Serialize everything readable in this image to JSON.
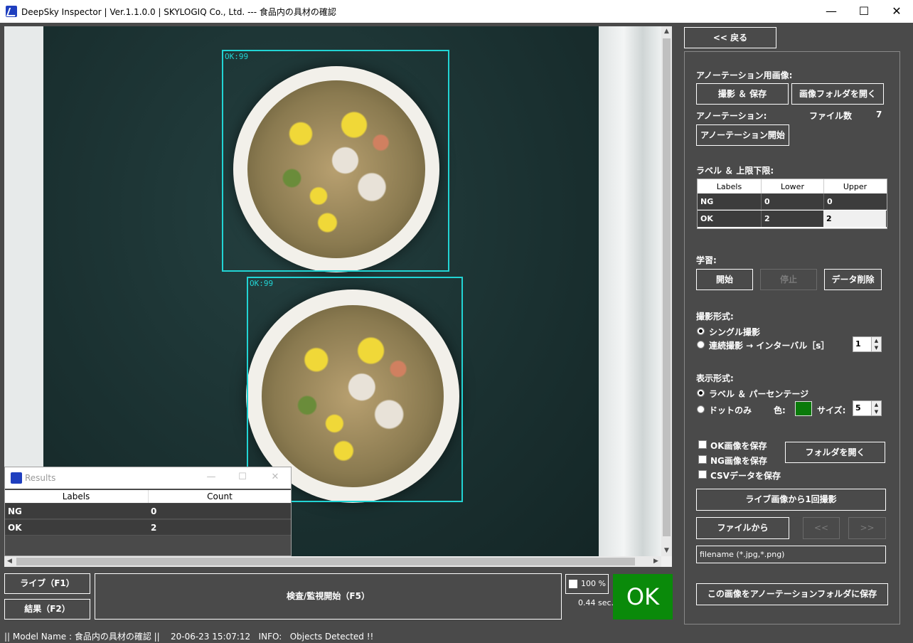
{
  "window": {
    "title": "DeepSky Inspector | Ver.1.1.0.0 | SKYLOGIQ Co., Ltd. --- 食品内の具材の確認",
    "controls": {
      "minimize": "—",
      "maximize": "☐",
      "close": "✕"
    }
  },
  "viewer": {
    "detections": [
      {
        "label": "OK:99"
      },
      {
        "label": "OK:99"
      }
    ]
  },
  "results_window": {
    "title": "Results",
    "controls": {
      "minimize": "—",
      "maximize": "☐",
      "close": "✕"
    },
    "columns": [
      "Labels",
      "Count"
    ],
    "rows": [
      {
        "label": "NG",
        "count": "0"
      },
      {
        "label": "OK",
        "count": "2"
      }
    ]
  },
  "bottom": {
    "live_button": "ライブ（F1）",
    "result_button": "結果（F2）",
    "inspect_button": "検査/監視開始（F5）",
    "percent_label": "100 %",
    "time_label": "0.44 sec.",
    "result_indicator": "OK",
    "result_color": "#0a8a0a"
  },
  "status": {
    "text": "|| Model Name : 食品内の具材の確認 ||    20-06-23 15:07:12   INFO:   Objects Detected !!"
  },
  "panel": {
    "back_button": "<< 戻る",
    "annotation_image_heading": "アノーテーション用画像:",
    "capture_save_button": "撮影 ＆ 保存",
    "open_image_folder_button": "画像フォルダを開く",
    "annotation_heading": "アノーテーション:",
    "file_count_label": "ファイル数",
    "file_count_value": "7",
    "annotation_start_button": "アノーテーション開始",
    "label_limits_heading": "ラベル ＆ 上限下限:",
    "label_table": {
      "columns": [
        "Labels",
        "Lower",
        "Upper"
      ],
      "rows": [
        {
          "label": "NG",
          "lower": "0",
          "upper": "0"
        },
        {
          "label": "OK",
          "lower": "2",
          "upper": "2"
        }
      ]
    },
    "training_heading": "学習:",
    "train_start_button": "開始",
    "train_stop_button": "停止",
    "data_delete_button": "データ削除",
    "capture_mode_heading": "撮影形式:",
    "capture_single": "シングル撮影",
    "capture_continuous": "連続撮影 → インターバル［s］",
    "interval_value": "1",
    "display_mode_heading": "表示形式:",
    "display_label_percent": "ラベル ＆ パーセンテージ",
    "display_dots": "ドットのみ",
    "color_label": "色:",
    "dot_color": "#0a7a0a",
    "size_label": "サイズ:",
    "size_value": "5",
    "save_ok_label": "OK画像を保存",
    "save_ng_label": "NG画像を保存",
    "save_csv_label": "CSVデータを保存",
    "open_folder_button": "フォルダを開く",
    "capture_once_button": "ライブ画像から1回撮影",
    "from_file_button": "ファイルから",
    "prev_button": "<<",
    "next_button": ">>",
    "filename_placeholder": "filename (*.jpg,*.png)",
    "save_to_annotation_button": "この画像をアノーテーションフォルダに保存"
  }
}
